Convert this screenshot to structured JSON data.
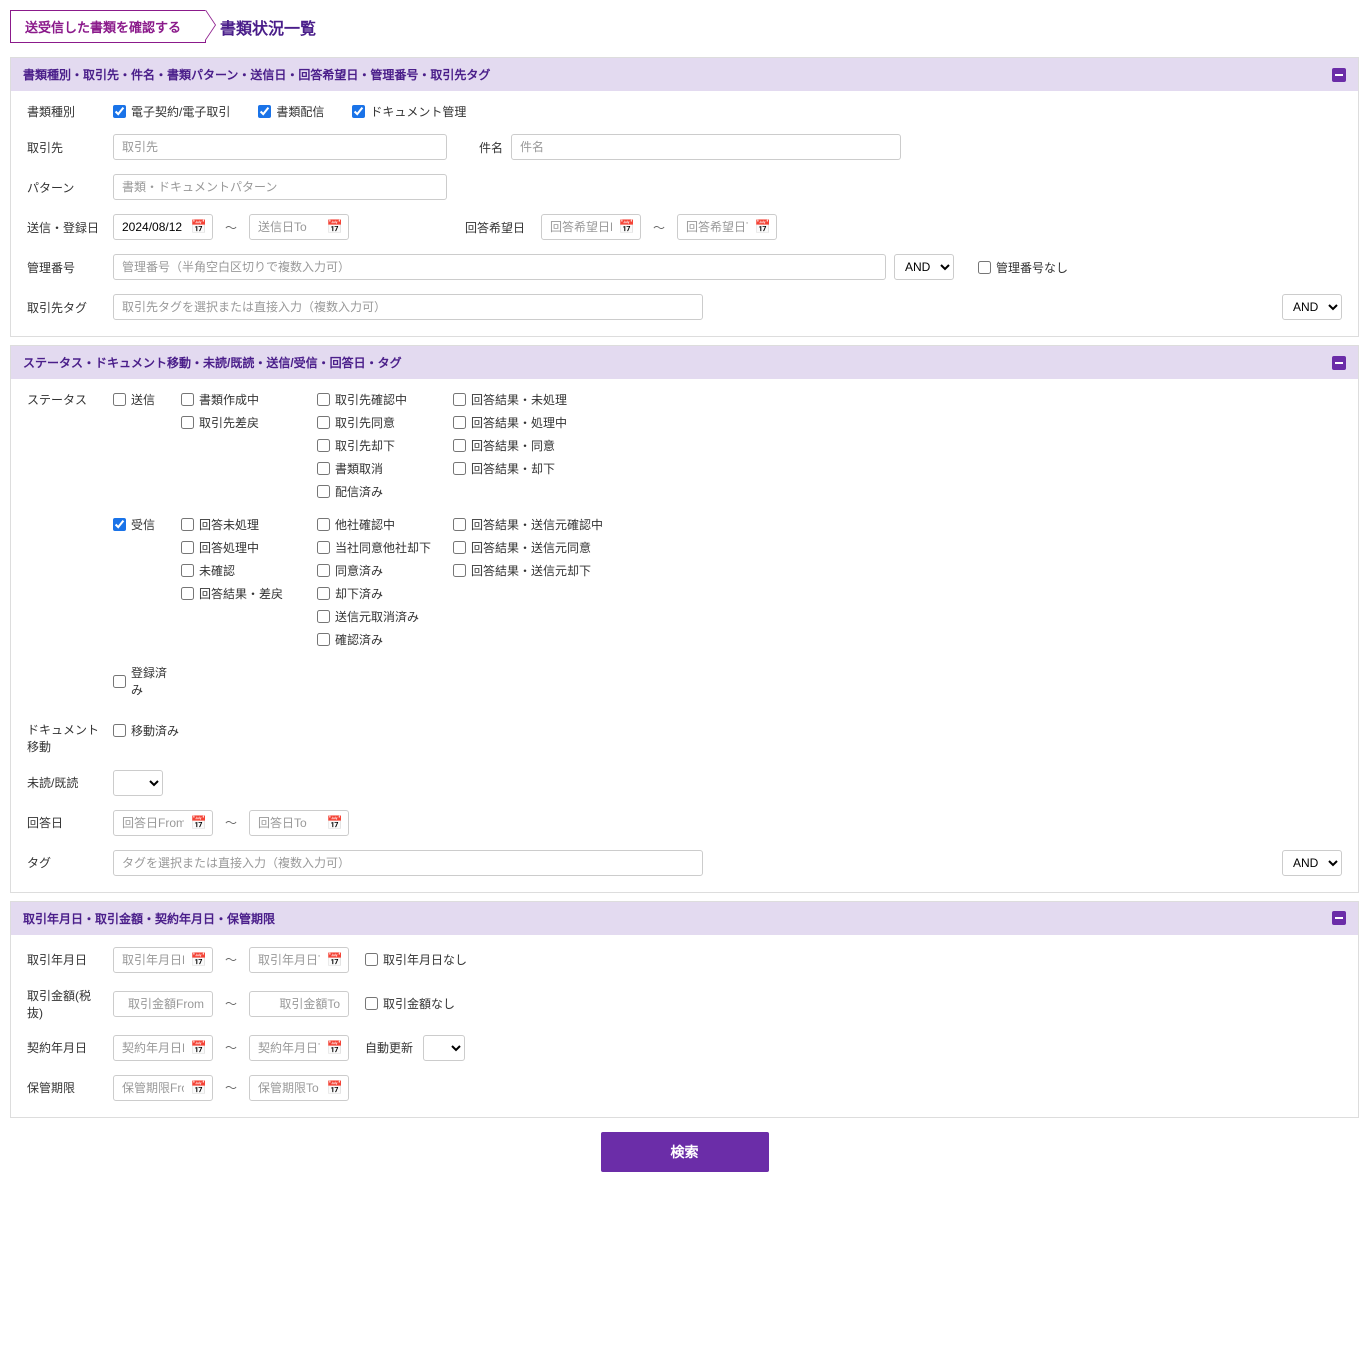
{
  "header": {
    "breadcrumb": "送受信した書類を確認する",
    "title": "書類状況一覧"
  },
  "panel1": {
    "title": "書類種別・取引先・件名・書類パターン・送信日・回答希望日・管理番号・取引先タグ",
    "labels": {
      "docType": "書類種別",
      "partner": "取引先",
      "subject": "件名",
      "pattern": "パターン",
      "sendDate": "送信・登録日",
      "replyDate": "回答希望日",
      "mgmtNo": "管理番号",
      "partnerTag": "取引先タグ"
    },
    "docTypes": {
      "electronic": "電子契約/電子取引",
      "distribute": "書類配信",
      "docMgmt": "ドキュメント管理"
    },
    "placeholders": {
      "partner": "取引先",
      "subject": "件名",
      "pattern": "書類・ドキュメントパターン",
      "sendTo": "送信日To",
      "replyFrom": "回答希望日From",
      "replyTo": "回答希望日To",
      "mgmtNo": "管理番号（半角空白区切りで複数入力可）",
      "partnerTag": "取引先タグを選択または直接入力（複数入力可）"
    },
    "sendFrom": "2024/08/12",
    "sep": "～",
    "and": "AND",
    "noMgmtNo": "管理番号なし"
  },
  "panel2": {
    "title": "ステータス・ドキュメント移動・未読/既読・送信/受信・回答日・タグ",
    "labels": {
      "status": "ステータス",
      "docMove": "ドキュメント移動",
      "readStatus": "未読/既読",
      "replyDate": "回答日",
      "tag": "タグ"
    },
    "send": "送信",
    "recv": "受信",
    "registered": "登録済み",
    "moved": "移動済み",
    "sendStatuses": {
      "col1": [
        "書類作成中",
        "取引先差戻"
      ],
      "col2": [
        "取引先確認中",
        "取引先同意",
        "取引先却下",
        "書類取消",
        "配信済み"
      ],
      "col3": [
        "回答結果・未処理",
        "回答結果・処理中",
        "回答結果・同意",
        "回答結果・却下"
      ]
    },
    "recvStatuses": {
      "col1": [
        "回答未処理",
        "回答処理中",
        "未確認",
        "回答結果・差戻"
      ],
      "col2": [
        "他社確認中",
        "当社同意他社却下",
        "同意済み",
        "却下済み",
        "送信元取消済み",
        "確認済み"
      ],
      "col3": [
        "回答結果・送信元確認中",
        "回答結果・送信元同意",
        "回答結果・送信元却下"
      ]
    },
    "placeholders": {
      "replyFrom": "回答日From",
      "replyTo": "回答日To",
      "tag": "タグを選択または直接入力（複数入力可）"
    },
    "sep": "～",
    "and": "AND"
  },
  "panel3": {
    "title": "取引年月日・取引金額・契約年月日・保管期限",
    "labels": {
      "txnDate": "取引年月日",
      "txnAmount": "取引金額(税抜)",
      "contractDate": "契約年月日",
      "autoRenew": "自動更新",
      "retention": "保管期限"
    },
    "placeholders": {
      "txnFrom": "取引年月日From",
      "txnTo": "取引年月日To",
      "amtFrom": "取引金額From",
      "amtTo": "取引金額To",
      "conFrom": "契約年月日From",
      "conTo": "契約年月日To",
      "retFrom": "保管期限From",
      "retTo": "保管期限To"
    },
    "noTxnDate": "取引年月日なし",
    "noTxnAmount": "取引金額なし",
    "sep": "～"
  },
  "search": "検索",
  "calIcon": "📅"
}
